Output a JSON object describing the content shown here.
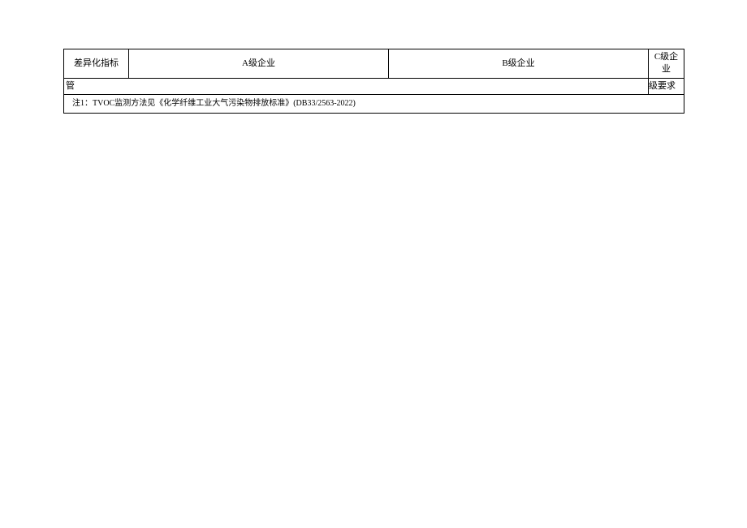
{
  "table": {
    "headers": {
      "col1": "差异化指标",
      "col2": "A级企业",
      "col3": "B级企业",
      "col4": "C级企业"
    },
    "row2": {
      "left": "管",
      "right": "级要求"
    },
    "note": "注1：TVOC监测方法见《化学纤维工业大气污染物排放标准》(DB33/2563-2022)"
  }
}
